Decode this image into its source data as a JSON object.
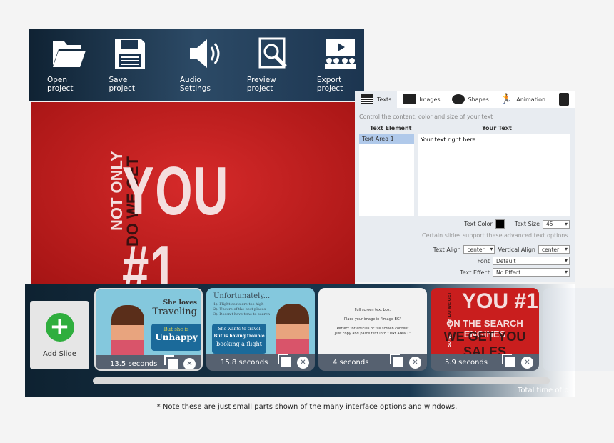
{
  "toolbar": {
    "items": [
      {
        "label": "Open project",
        "icon": "folder-open-icon"
      },
      {
        "label": "Save project",
        "icon": "floppy-disk-icon"
      },
      {
        "label": "Audio Settings",
        "icon": "speaker-icon"
      },
      {
        "label": "Preview project",
        "icon": "magnifier-preview-icon"
      },
      {
        "label": "Export project",
        "icon": "presentation-audience-icon"
      }
    ]
  },
  "slide": {
    "vertical_line1": "NOT ONLY",
    "vertical_line2": "DO WE GET",
    "headline": "YOU #1"
  },
  "panel": {
    "tabs": [
      {
        "label": "Texts",
        "icon": "text-lines-icon"
      },
      {
        "label": "Images",
        "icon": "image-icon"
      },
      {
        "label": "Shapes",
        "icon": "speech-bubble-icon"
      },
      {
        "label": "Animation",
        "icon": "running-man-icon"
      },
      {
        "label": "",
        "icon": "add-document-icon"
      }
    ],
    "hint": "Control the content, color and size of your text",
    "col_element": "Text Element",
    "col_text": "Your Text",
    "elements": [
      "Text Area 1"
    ],
    "text_value": "Your text right here",
    "text_color_label": "Text Color",
    "text_color": "#000000",
    "text_size_label": "Text Size",
    "text_size": "45",
    "advanced_hint": "Certain slides support these advanced text options.",
    "text_align_label": "Text Align",
    "text_align": "center",
    "vertical_align_label": "Vertical Align",
    "vertical_align": "center",
    "font_label": "Font",
    "font": "Default",
    "effect_label": "Text Effect",
    "effect": "No Effect"
  },
  "filmstrip": {
    "add_label": "Add Slide",
    "slides": [
      {
        "duration": "13.5 seconds",
        "t1": "She loves",
        "t2": "Traveling",
        "t3": "But she is",
        "t4": "Unhappy"
      },
      {
        "duration": "15.8 seconds",
        "t1": "Unfortunately...",
        "t2": "1). Flight costs are too high",
        "t3": "2). Unsure of the best places",
        "t4": "3). Doesn't have time to search",
        "t5": "She wants to travel",
        "t6": "But is having trouble",
        "t7": "booking a flight"
      },
      {
        "duration": "4 seconds",
        "t1": "Full screen text box.",
        "t2": "Place your image in \"Image BG\"",
        "t3": "Perfect for articles or full screen content",
        "t4": "Just copy and paste text into \"Text Area 1\""
      },
      {
        "duration": "5.9 seconds",
        "t1": "SO NOT ONLY",
        "t2": "DO WE GET",
        "t3": "YOU #1",
        "t4": "ON THE SEARCH ENGINES",
        "t5": "WE GET YOU SALES"
      }
    ],
    "total_label": "Total time of p"
  },
  "note": "* Note these are just small parts shown of the many interface options and windows."
}
